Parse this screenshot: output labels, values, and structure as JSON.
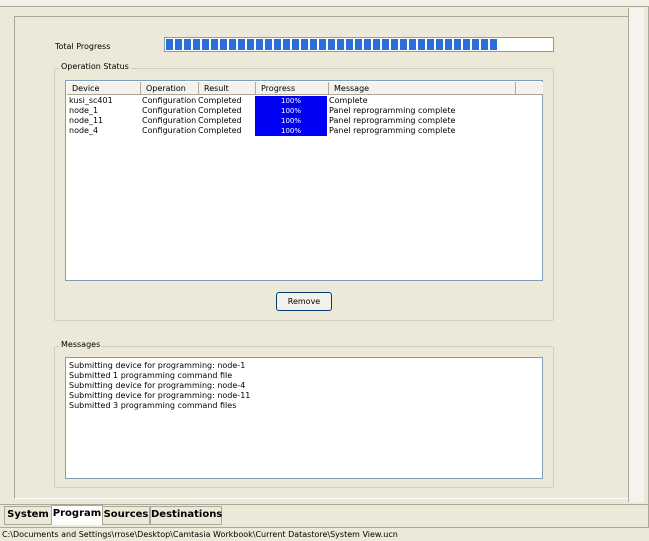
{
  "total_progress": {
    "label": "Total Progress",
    "fraction": 1.0,
    "segments": 37
  },
  "operation_status": {
    "title": "Operation Status",
    "columns": [
      "Device",
      "Operation",
      "Result",
      "Progress",
      "Message"
    ],
    "rows": [
      {
        "device": "kusi_sc401",
        "operation": "Configuration",
        "result": "Completed",
        "progress": "100%",
        "message": "Complete"
      },
      {
        "device": "node_1",
        "operation": "Configuration",
        "result": "Completed",
        "progress": "100%",
        "message": "Panel reprogramming complete"
      },
      {
        "device": "node_11",
        "operation": "Configuration",
        "result": "Completed",
        "progress": "100%",
        "message": "Panel reprogramming complete"
      },
      {
        "device": "node_4",
        "operation": "Configuration",
        "result": "Completed",
        "progress": "100%",
        "message": "Panel reprogramming complete"
      }
    ],
    "remove_label": "Remove"
  },
  "messages": {
    "title": "Messages",
    "lines": [
      "Submitting device for programming: node-1",
      "Submitted 1 programming command file",
      "Submitting device for programming: node-4",
      "Submitting device for programming: node-11",
      "Submitted 3 programming command files"
    ]
  },
  "tabs": [
    {
      "label": "System",
      "active": false
    },
    {
      "label": "Program",
      "active": true
    },
    {
      "label": "Sources",
      "active": false
    },
    {
      "label": "Destinations",
      "active": false
    }
  ],
  "status_bar": {
    "path": "C:\\Documents and Settings\\rrose\\Desktop\\Camtasia Workbook\\Current Datastore\\System View.ucn"
  },
  "colors": {
    "progress_blue": "#0000f5",
    "total_progress_blue": "#2a6fd8",
    "window_bg": "#ece9d8"
  }
}
